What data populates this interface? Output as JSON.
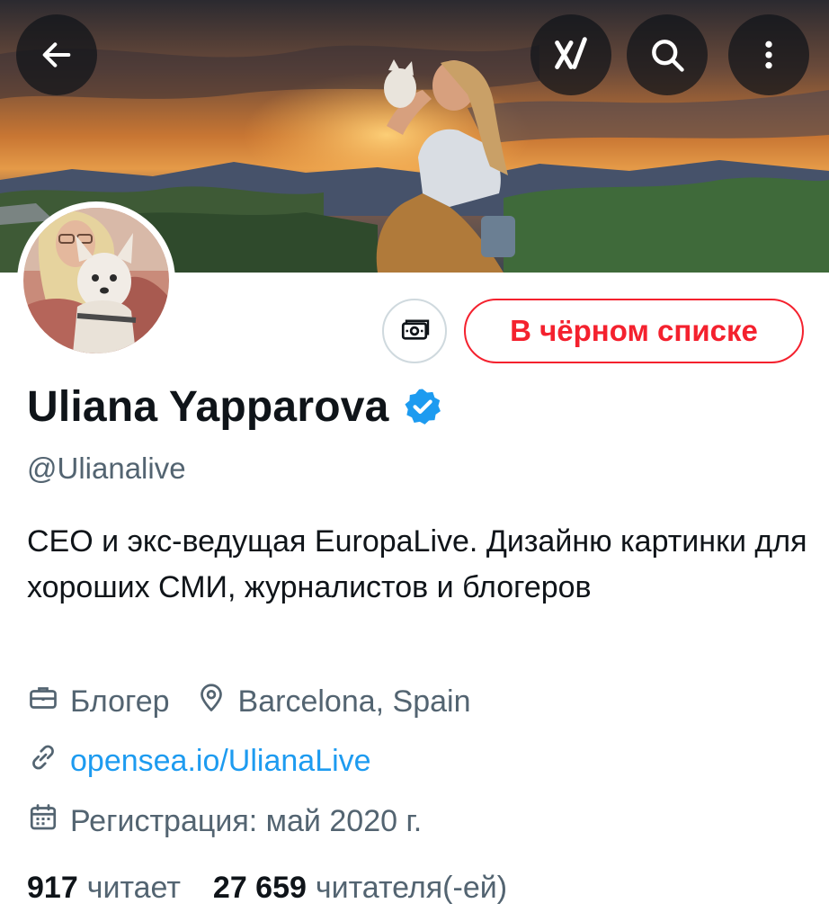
{
  "header": {
    "back_icon": "arrow-left-icon",
    "grok_icon": "grok-icon",
    "search_icon": "search-icon",
    "more_icon": "more-vertical-icon"
  },
  "profile": {
    "display_name": "Uliana Yapparova",
    "verified_icon": "verified-badge-icon",
    "handle": "@Ulianalive",
    "bio": "CEO и экс-ведущая EuropaLive. Дизайню картинки для хороших СМИ, журналистов и блогеров",
    "subscriptions_icon": "subscriptions-icon",
    "blocked_label": "В чёрном списке"
  },
  "meta": {
    "profession_icon": "briefcase-icon",
    "profession": "Блогер",
    "location_icon": "location-pin-icon",
    "location": "Barcelona, Spain",
    "link_icon": "link-icon",
    "website": "opensea.io/UlianaLive",
    "join_icon": "calendar-icon",
    "joined": "Регистрация: май 2020 г."
  },
  "stats": {
    "following_count": "917",
    "following_label": "читает",
    "followers_count": "27 659",
    "followers_label": "читателя(-ей)"
  },
  "colors": {
    "accent": "#1d9bf0",
    "blocked": "#f4212e",
    "secondary_text": "#536471",
    "primary_text": "#0f1419"
  }
}
